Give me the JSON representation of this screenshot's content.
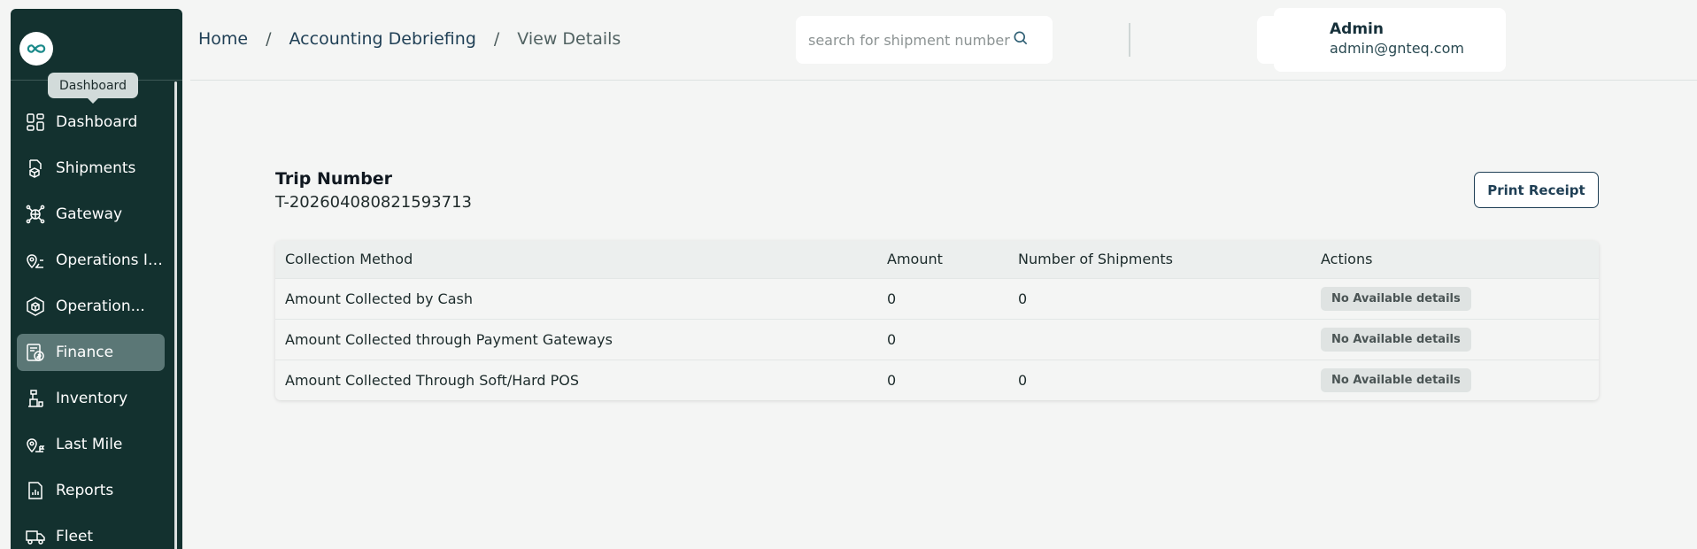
{
  "sidebar": {
    "tooltip": "Dashboard",
    "items": [
      {
        "label": "Dashboard",
        "icon": "dashboard-icon",
        "active": false
      },
      {
        "label": "Shipments",
        "icon": "shipments-icon",
        "active": false
      },
      {
        "label": "Gateway",
        "icon": "gateway-icon",
        "active": false
      },
      {
        "label": "Operations IN...",
        "icon": "operations-in-icon",
        "active": false
      },
      {
        "label": "Operation...",
        "icon": "operations-icon",
        "active": false
      },
      {
        "label": "Finance",
        "icon": "finance-icon",
        "active": true
      },
      {
        "label": "Inventory",
        "icon": "inventory-icon",
        "active": false
      },
      {
        "label": "Last Mile",
        "icon": "last-mile-icon",
        "active": false
      },
      {
        "label": "Reports",
        "icon": "reports-icon",
        "active": false
      },
      {
        "label": "Fleet",
        "icon": "fleet-icon",
        "active": false
      }
    ]
  },
  "breadcrumb": {
    "home": "Home",
    "section": "Accounting Debriefing",
    "current": "View Details",
    "separator": "/"
  },
  "search": {
    "placeholder": "search for shipment number",
    "value": ""
  },
  "user": {
    "name": "Admin",
    "email": "admin@gnteq.com"
  },
  "trip": {
    "label": "Trip Number",
    "number": "T-202604080821593713"
  },
  "print_button": "Print Receipt",
  "table": {
    "headers": [
      "Collection Method",
      "Amount",
      "Number of Shipments",
      "Actions"
    ],
    "rows": [
      {
        "method": "Amount Collected by Cash",
        "amount": "0",
        "shipments": "0",
        "action": "No Available details"
      },
      {
        "method": "Amount Collected through Payment Gateways",
        "amount": "0",
        "shipments": "",
        "action": "No Available details"
      },
      {
        "method": "Amount Collected Through Soft/Hard POS",
        "amount": "0",
        "shipments": "0",
        "action": "No Available details"
      }
    ]
  },
  "colors": {
    "sidebar_bg": "#13312f",
    "sidebar_active": "#5b7776",
    "accent": "#1f3f55",
    "page_bg": "#f4f5f4"
  }
}
